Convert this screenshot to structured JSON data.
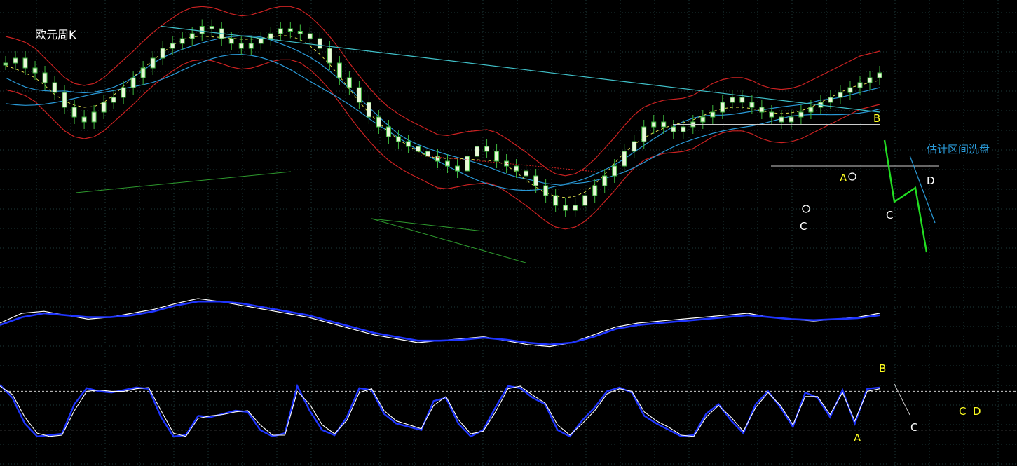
{
  "title": "欧元周K",
  "colors": {
    "background": "#000000",
    "grid": "#1e3a3a",
    "candle": "#e8f8d8",
    "candle_outline": "#3cb43c",
    "bollinger": "#cc2222",
    "ma_blue": "#2a9ad8",
    "ma_yellow": "#dede50",
    "trend_cyan": "#40c0c8",
    "trend_green": "#2e9a2e",
    "projection": "#22dd22",
    "macd_white": "#ffffff",
    "macd_blue": "#1f35ff",
    "ann_yellow": "#ffff20",
    "ann_blue": "#2a9ad8",
    "ann_white": "#ffffff"
  },
  "annotations": {
    "wash_text": "估计区间洗盘",
    "top_B": "B",
    "top_A": "A",
    "top_C1": "C",
    "top_C2": "C",
    "top_D": "D",
    "bottom_B": "B",
    "bottom_A": "A",
    "bottom_C": "C",
    "bottom_CD": "C  D"
  },
  "chart_data": [
    {
      "type": "candlestick",
      "title": "欧元周K",
      "y_relative_range": [
        0,
        100
      ],
      "closes": [
        80,
        82,
        78,
        76,
        72,
        68,
        62,
        58,
        56,
        60,
        64,
        66,
        70,
        74,
        78,
        82,
        86,
        88,
        90,
        92,
        95,
        94,
        90,
        88,
        86,
        88,
        90,
        92,
        94,
        93,
        92,
        90,
        86,
        80,
        74,
        70,
        64,
        58,
        54,
        50,
        48,
        46,
        44,
        42,
        40,
        38,
        36,
        42,
        46,
        44,
        40,
        38,
        36,
        34,
        30,
        26,
        22,
        20,
        22,
        26,
        30,
        34,
        38,
        44,
        48,
        54,
        56,
        54,
        52,
        54,
        56,
        58,
        60,
        64,
        66,
        64,
        62,
        60,
        58,
        56,
        58,
        60,
        62,
        64,
        66,
        68,
        70,
        72,
        74,
        76
      ],
      "upper_trendline_start": 95,
      "upper_trendline_end": 60,
      "horizontal_level": 55,
      "support_level": 38
    },
    {
      "type": "line",
      "series": [
        {
          "values": [
            60,
            70,
            72,
            68,
            64,
            66,
            70,
            74,
            80,
            85,
            82,
            78,
            74,
            70,
            66,
            60,
            54,
            48,
            44,
            40,
            42,
            44,
            46,
            42,
            38,
            36,
            40,
            48,
            56,
            60,
            62,
            64,
            66,
            68,
            70,
            66,
            64,
            62,
            64,
            66,
            70
          ]
        },
        {
          "values": [
            58,
            66,
            70,
            68,
            66,
            66,
            68,
            72,
            78,
            82,
            82,
            80,
            76,
            72,
            68,
            62,
            56,
            50,
            46,
            42,
            42,
            43,
            45,
            43,
            40,
            38,
            40,
            46,
            54,
            58,
            60,
            62,
            64,
            66,
            68,
            66,
            64,
            63,
            64,
            65,
            68
          ]
        }
      ]
    },
    {
      "type": "line",
      "ylim": [
        0,
        100
      ],
      "levels": [
        80,
        20
      ],
      "series": [
        {
          "values": [
            90,
            70,
            30,
            10,
            12,
            14,
            60,
            85,
            80,
            78,
            82,
            86,
            84,
            40,
            10,
            12,
            42,
            40,
            45,
            50,
            48,
            20,
            10,
            15,
            88,
            50,
            20,
            12,
            40,
            85,
            82,
            45,
            30,
            25,
            20,
            65,
            70,
            30,
            10,
            20,
            55,
            88,
            85,
            70,
            60,
            20,
            10,
            35,
            55,
            80,
            86,
            78,
            42,
            30,
            20,
            10,
            12,
            45,
            60,
            35,
            15,
            60,
            80,
            55,
            25,
            78,
            70,
            40,
            82,
            30,
            84,
            86
          ]
        },
        {
          "values": [
            88,
            75,
            40,
            15,
            10,
            12,
            50,
            80,
            82,
            80,
            80,
            84,
            86,
            50,
            15,
            10,
            38,
            42,
            44,
            48,
            50,
            28,
            12,
            12,
            80,
            60,
            28,
            14,
            35,
            78,
            84,
            50,
            34,
            28,
            22,
            58,
            72,
            36,
            14,
            18,
            48,
            84,
            88,
            74,
            62,
            28,
            12,
            30,
            50,
            76,
            84,
            80,
            48,
            34,
            24,
            12,
            10,
            40,
            58,
            40,
            18,
            55,
            78,
            58,
            28,
            72,
            72,
            44,
            78,
            34,
            80,
            84
          ]
        }
      ]
    }
  ]
}
